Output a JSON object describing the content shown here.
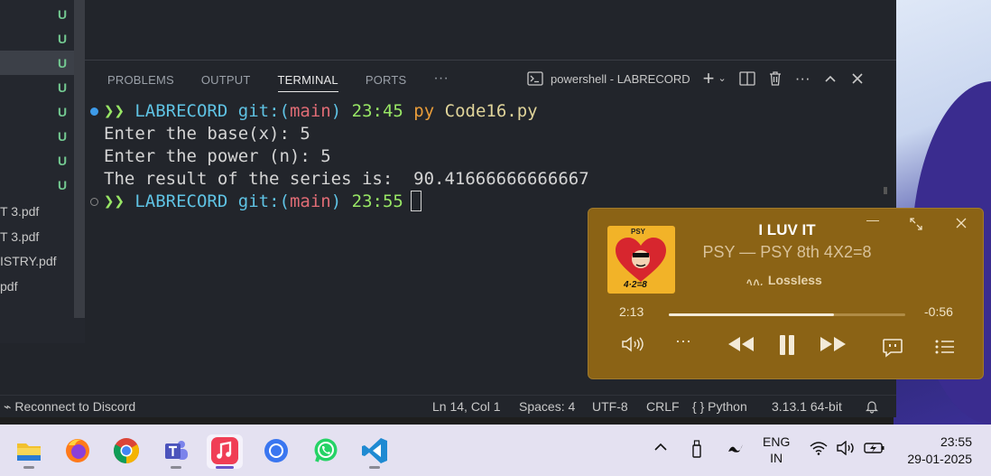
{
  "explorer": {
    "rows": [
      {
        "name": "",
        "status": "U"
      },
      {
        "name": "",
        "status": "U"
      },
      {
        "name": "",
        "status": "U"
      },
      {
        "name": "",
        "status": "U"
      },
      {
        "name": "",
        "status": "U"
      },
      {
        "name": "",
        "status": "U"
      },
      {
        "name": "",
        "status": "U"
      },
      {
        "name": "",
        "status": "U"
      },
      {
        "name": "T 3.pdf",
        "status": ""
      },
      {
        "name": "T 3.pdf",
        "status": ""
      },
      {
        "name": "ISTRY.pdf",
        "status": ""
      },
      {
        "name": "pdf",
        "status": ""
      }
    ]
  },
  "panel": {
    "tabs": [
      "PROBLEMS",
      "OUTPUT",
      "TERMINAL",
      "PORTS"
    ],
    "active_tab": "TERMINAL",
    "terminal_name": "powershell - LABRECORD"
  },
  "terminal": {
    "prompt1": {
      "arrows": "❯❯",
      "dir": "LABRECORD",
      "git": "git:",
      "branch_open": "(",
      "branch": "main",
      "branch_close": ")",
      "time": "23:45",
      "cmd1": "py",
      "cmd2": "Code16.py"
    },
    "out1": "Enter the base(x): 5",
    "out2": "Enter the power (n): 5",
    "out3": "The result of the series is:  90.41666666666667",
    "prompt2": {
      "arrows": "❯❯",
      "dir": "LABRECORD",
      "git": "git:",
      "branch_open": "(",
      "branch": "main",
      "branch_close": ")",
      "time": "23:55"
    }
  },
  "status_bar": {
    "discord": "Reconnect to Discord",
    "position": "Ln 14, Col 1",
    "spaces": "Spaces: 4",
    "encoding": "UTF-8",
    "eol": "CRLF",
    "language_icon": "{ }",
    "language": "Python",
    "version": "3.13.1 64-bit"
  },
  "player": {
    "title": "I LUV IT",
    "artist_album": "PSY — PSY 8th 4X2=8",
    "quality": "Lossless",
    "elapsed": "2:13",
    "remaining": "-0:56",
    "progress": 0.7,
    "album_art_text": "PSY",
    "album_art_num": "4·2=8",
    "accent": "#8b6315"
  },
  "taskbar": {
    "apps": [
      "file-explorer",
      "firefox",
      "chrome",
      "teams",
      "music",
      "signal",
      "whatsapp",
      "vscode"
    ],
    "active_app": "music",
    "lang_top": "ENG",
    "lang_bottom": "IN",
    "time": "23:55",
    "date": "29-01-2025"
  }
}
